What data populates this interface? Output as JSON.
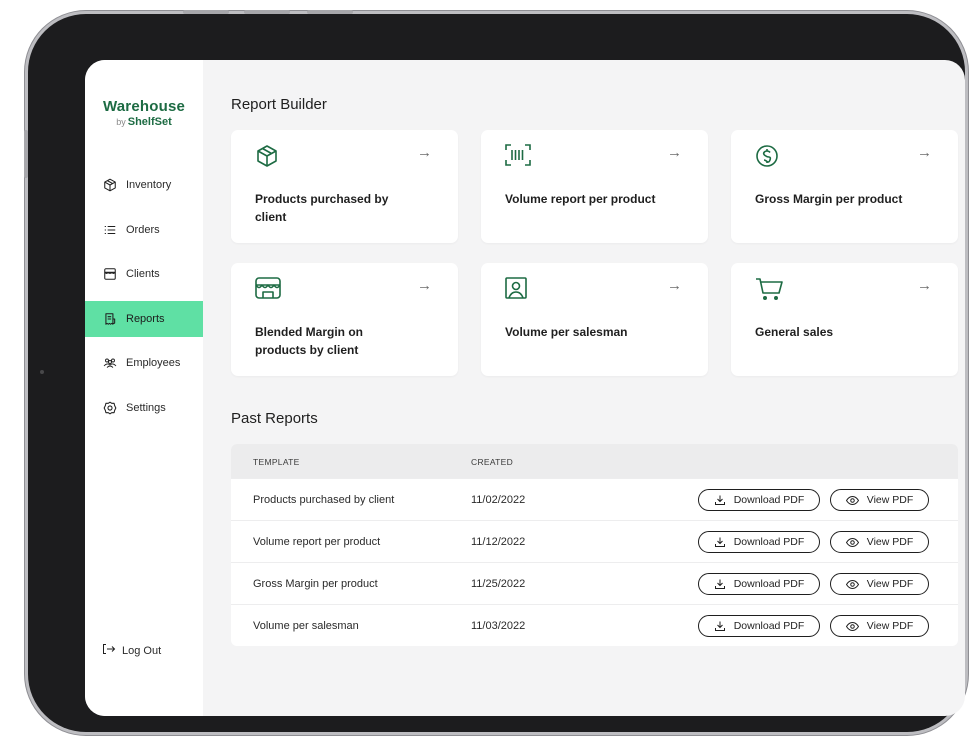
{
  "brand": {
    "name": "Warehouse",
    "by": "by",
    "sub": "ShelfSet"
  },
  "sidebar": {
    "items": [
      {
        "label": "Inventory",
        "icon": "box-icon",
        "active": false
      },
      {
        "label": "Orders",
        "icon": "list-icon",
        "active": false
      },
      {
        "label": "Clients",
        "icon": "store-icon",
        "active": false
      },
      {
        "label": "Reports",
        "icon": "receipt-icon",
        "active": true
      },
      {
        "label": "Employees",
        "icon": "people-icon",
        "active": false
      },
      {
        "label": "Settings",
        "icon": "gear-icon",
        "active": false
      }
    ],
    "logout": "Log Out"
  },
  "report_builder": {
    "title": "Report Builder",
    "arrow": "→",
    "cards": [
      {
        "label": "Products purchased by client",
        "icon": "box-icon"
      },
      {
        "label": "Volume report per product",
        "icon": "barcode-icon"
      },
      {
        "label": "Gross Margin per product",
        "icon": "dollar-icon"
      },
      {
        "label": "Blended Margin on products by client",
        "icon": "store-icon"
      },
      {
        "label": "Volume per salesman",
        "icon": "person-icon"
      },
      {
        "label": "General sales",
        "icon": "cart-icon"
      }
    ]
  },
  "past_reports": {
    "title": "Past Reports",
    "columns": [
      "TEMPLATE",
      "CREATED"
    ],
    "download_label": "Download PDF",
    "view_label": "View PDF",
    "rows": [
      {
        "template": "Products purchased by client",
        "created": "11/02/2022"
      },
      {
        "template": "Volume report per product",
        "created": "11/12/2022"
      },
      {
        "template": "Gross Margin per product",
        "created": "11/25/2022"
      },
      {
        "template": "Volume per salesman",
        "created": "11/03/2022"
      }
    ]
  },
  "colors": {
    "brand": "#1d6b43",
    "active_nav": "#5fe0a4",
    "background": "#f4f4f5"
  }
}
